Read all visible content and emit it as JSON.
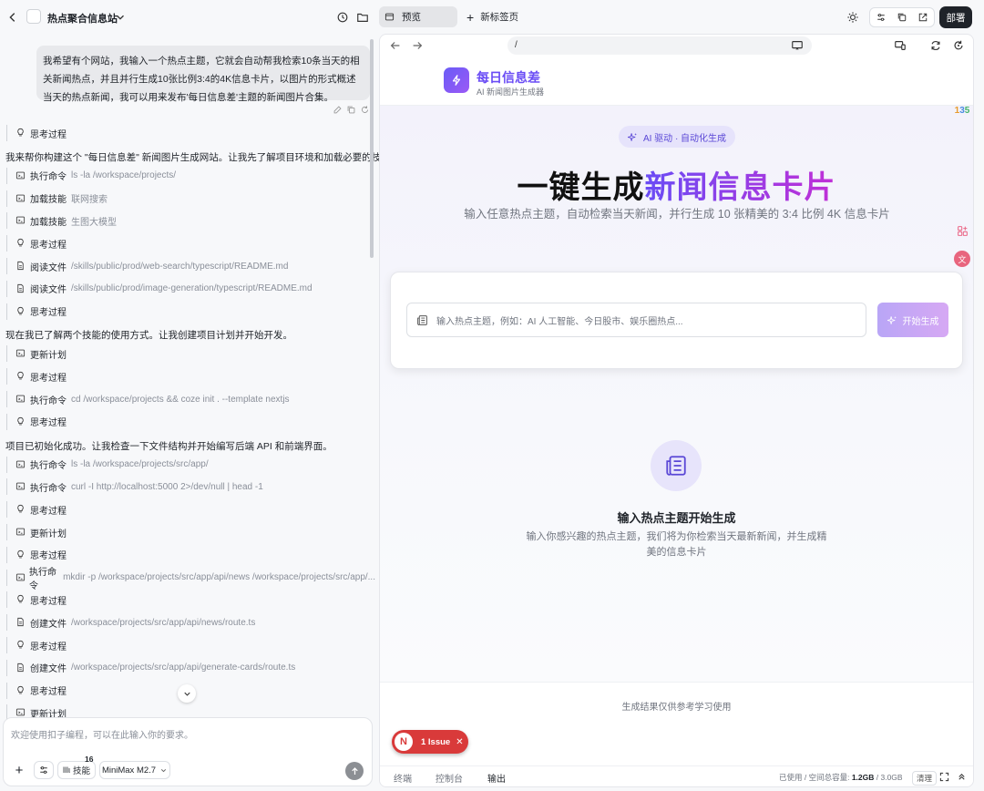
{
  "topbar": {
    "project_name": "热点聚合信息站",
    "preview_tab": "预览",
    "new_tab": "新标签页",
    "deploy": "部署"
  },
  "chat": {
    "user_message": "我希望有个网站，我输入一个热点主题，它就会自动帮我检索10条当天的相关新闻热点，并且并行生成10张比例3:4的4K信息卡片，以图片的形式概述当天的热点新闻，我可以用来发布'每日信息差'主题的新闻图片合集。",
    "lines": [
      {
        "type": "step",
        "icon": "bulb",
        "label": "思考过程",
        "arg": ""
      },
      {
        "type": "text",
        "text": "我来帮你构建这个 \"每日信息差\" 新闻图片生成网站。让我先了解项目环境和加载必要的技能。"
      },
      {
        "type": "step",
        "icon": "terminal",
        "label": "执行命令",
        "arg": "ls -la /workspace/projects/"
      },
      {
        "type": "step",
        "icon": "terminal",
        "label": "加载技能",
        "arg": "联网搜索"
      },
      {
        "type": "step",
        "icon": "terminal",
        "label": "加载技能",
        "arg": "生图大模型"
      },
      {
        "type": "step",
        "icon": "bulb",
        "label": "思考过程",
        "arg": ""
      },
      {
        "type": "step",
        "icon": "file",
        "label": "阅读文件",
        "arg": "/skills/public/prod/web-search/typescript/README.md"
      },
      {
        "type": "step",
        "icon": "file",
        "label": "阅读文件",
        "arg": "/skills/public/prod/image-generation/typescript/README.md"
      },
      {
        "type": "step",
        "icon": "bulb",
        "label": "思考过程",
        "arg": ""
      },
      {
        "type": "text",
        "text": "现在我已了解两个技能的使用方式。让我创建项目计划并开始开发。"
      },
      {
        "type": "step",
        "icon": "terminal",
        "label": "更新计划",
        "arg": ""
      },
      {
        "type": "step",
        "icon": "bulb",
        "label": "思考过程",
        "arg": ""
      },
      {
        "type": "step",
        "icon": "terminal",
        "label": "执行命令",
        "arg": "cd /workspace/projects && coze init . --template nextjs"
      },
      {
        "type": "step",
        "icon": "bulb",
        "label": "思考过程",
        "arg": ""
      },
      {
        "type": "text",
        "text": "项目已初始化成功。让我检查一下文件结构并开始编写后端 API 和前端界面。"
      },
      {
        "type": "step",
        "icon": "terminal",
        "label": "执行命令",
        "arg": "ls -la /workspace/projects/src/app/"
      },
      {
        "type": "step",
        "icon": "terminal",
        "label": "执行命令",
        "arg": "curl -I http://localhost:5000 2>/dev/null | head -1"
      },
      {
        "type": "step",
        "icon": "bulb",
        "label": "思考过程",
        "arg": ""
      },
      {
        "type": "step",
        "icon": "terminal",
        "label": "更新计划",
        "arg": ""
      },
      {
        "type": "step",
        "icon": "bulb",
        "label": "思考过程",
        "arg": ""
      },
      {
        "type": "step",
        "icon": "terminal",
        "label": "执行命令",
        "arg": "mkdir -p /workspace/projects/src/app/api/news /workspace/projects/src/app/..."
      },
      {
        "type": "step",
        "icon": "bulb",
        "label": "思考过程",
        "arg": ""
      },
      {
        "type": "step",
        "icon": "file",
        "label": "创建文件",
        "arg": "/workspace/projects/src/app/api/news/route.ts"
      },
      {
        "type": "step",
        "icon": "bulb",
        "label": "思考过程",
        "arg": ""
      },
      {
        "type": "step",
        "icon": "file",
        "label": "创建文件",
        "arg": "/workspace/projects/src/app/api/generate-cards/route.ts"
      },
      {
        "type": "step",
        "icon": "bulb",
        "label": "思考过程",
        "arg": ""
      },
      {
        "type": "step",
        "icon": "terminal",
        "label": "更新计划",
        "arg": ""
      }
    ]
  },
  "composer": {
    "placeholder": "欢迎使用扣子编程，可以在此输入你的要求。",
    "skills_label": "技能",
    "skills_count": "16",
    "model": "MiniMax M2.7"
  },
  "preview": {
    "url": "/",
    "brand": "每日信息差",
    "brand_sub": "AI 新闻图片生成器",
    "pill": "AI 驱动 · 自动化生成",
    "headline_plain": "一键生成",
    "headline_highlight": "新闻信息卡片",
    "subtitle": "输入任意热点主题，自动检索当天新闻，并行生成 10 张精美的 3:4 比例 4K 信息卡片",
    "search_placeholder": "输入热点主题，例如：AI 人工智能、今日股市、娱乐圈热点...",
    "generate_button": "开始生成",
    "empty_title": "输入热点主题开始生成",
    "empty_sub": "输入你感兴趣的热点主题，我们将为你检索当天最新新闻，并生成精美的信息卡片",
    "footer_note": "生成结果仅供参考学习使用",
    "issue_letter": "N",
    "issue_label": "1 Issue"
  },
  "bottombar": {
    "tabs": [
      "终端",
      "控制台",
      "输出"
    ],
    "usage_prefix": "已使用 / 空间总容量: ",
    "usage_value": "1.2GB",
    "usage_total": " / 3.0GB",
    "clean": "清理"
  },
  "colors": {
    "accent": "#6a4cf5",
    "issue": "#d93a3a",
    "deploy_bg": "#1f2329"
  }
}
